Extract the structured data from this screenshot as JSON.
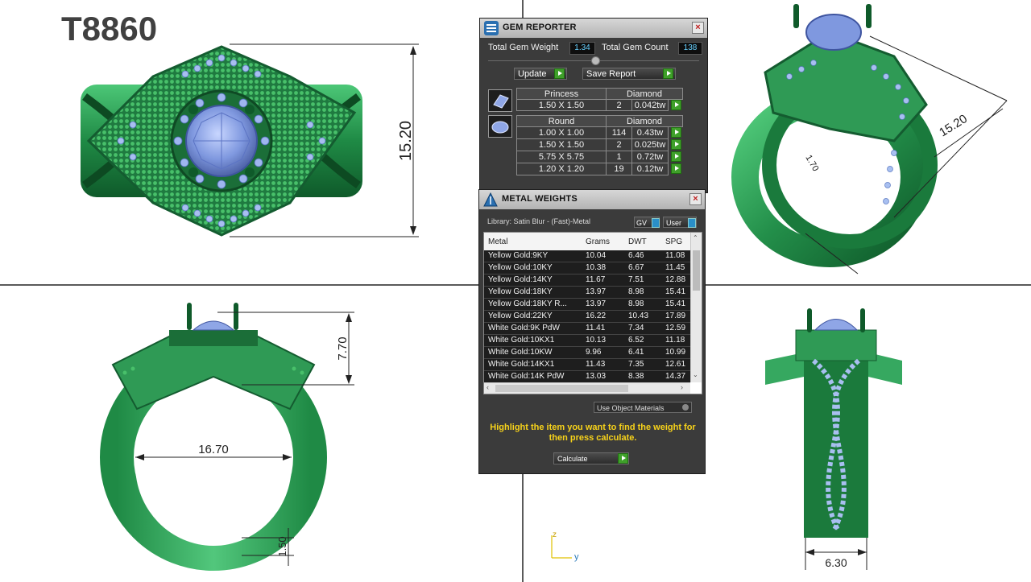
{
  "model_code": "T8860",
  "dimensions": {
    "top_height": "15.20",
    "iso_width": "15.20",
    "iso_small": "1.70",
    "front_height": "7.70",
    "inner_diameter": "16.70",
    "shank_thickness": "1.50",
    "side_width": "6.30"
  },
  "axes": {
    "z": "z",
    "y": "y"
  },
  "gem_reporter": {
    "title": "GEM REPORTER",
    "total_weight_label": "Total Gem Weight",
    "total_weight_value": "1.34",
    "total_count_label": "Total Gem Count",
    "total_count_value": "138",
    "update_label": "Update",
    "save_report_label": "Save Report",
    "groups": [
      {
        "shape": "Princess",
        "material": "Diamond",
        "rows": [
          {
            "size": "1.50 X 1.50",
            "count": "2",
            "weight": "0.042tw"
          }
        ]
      },
      {
        "shape": "Round",
        "material": "Diamond",
        "rows": [
          {
            "size": "1.00 X 1.00",
            "count": "114",
            "weight": "0.43tw"
          },
          {
            "size": "1.50 X 1.50",
            "count": "2",
            "weight": "0.025tw"
          },
          {
            "size": "5.75 X 5.75",
            "count": "1",
            "weight": "0.72tw"
          },
          {
            "size": "1.20 X 1.20",
            "count": "19",
            "weight": "0.12tw"
          }
        ]
      }
    ]
  },
  "metal_weights": {
    "title": "METAL WEIGHTS",
    "library": "Library: Satin Blur - (Fast)-Metal",
    "gv_label": "GV",
    "user_label": "User",
    "columns": [
      "Metal",
      "Grams",
      "DWT",
      "SPG"
    ],
    "rows": [
      [
        "Yellow Gold:9KY",
        "10.04",
        "6.46",
        "11.08"
      ],
      [
        "Yellow Gold:10KY",
        "10.38",
        "6.67",
        "11.45"
      ],
      [
        "Yellow Gold:14KY",
        "11.67",
        "7.51",
        "12.88"
      ],
      [
        "Yellow Gold:18KY",
        "13.97",
        "8.98",
        "15.41"
      ],
      [
        "Yellow Gold:18KY R...",
        "13.97",
        "8.98",
        "15.41"
      ],
      [
        "Yellow Gold:22KY",
        "16.22",
        "10.43",
        "17.89"
      ],
      [
        "White Gold:9K PdW",
        "11.41",
        "7.34",
        "12.59"
      ],
      [
        "White Gold:10KX1",
        "10.13",
        "6.52",
        "11.18"
      ],
      [
        "White Gold:10KW",
        "9.96",
        "6.41",
        "10.99"
      ],
      [
        "White Gold:14KX1",
        "11.43",
        "7.35",
        "12.61"
      ],
      [
        "White Gold:14K PdW",
        "13.03",
        "8.38",
        "14.37"
      ]
    ],
    "use_object_materials": "Use Object Materials",
    "hint": "Highlight the item you want to find the weight for then press calculate.",
    "calculate_label": "Calculate"
  },
  "colors": {
    "metal": "#2f9a55",
    "metal_dark": "#145c30",
    "gem": "#8fa6e6",
    "accent_green": "#3fa02a",
    "hint_yellow": "#f7d21a"
  }
}
